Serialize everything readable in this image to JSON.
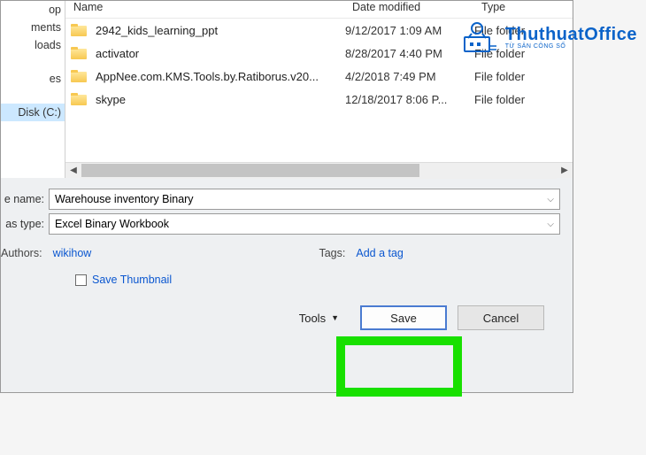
{
  "nav": {
    "items": [
      "op",
      "ments",
      "loads",
      "es",
      "",
      ""
    ],
    "selected": "Disk (C:)"
  },
  "columns": {
    "name": "Name",
    "date": "Date modified",
    "type": "Type"
  },
  "files": [
    {
      "name": "2942_kids_learning_ppt",
      "date": "9/12/2017 1:09 AM",
      "type": "File folder"
    },
    {
      "name": "activator",
      "date": "8/28/2017 4:40 PM",
      "type": "File folder"
    },
    {
      "name": "AppNee.com.KMS.Tools.by.Ratiborus.v20...",
      "date": "4/2/2018 7:49 PM",
      "type": "File folder"
    },
    {
      "name": "skype",
      "date": "12/18/2017 8:06 P...",
      "type": "File folder"
    }
  ],
  "form": {
    "name_label": "e name:",
    "name_value": "Warehouse inventory Binary",
    "type_label": "as type:",
    "type_value": "Excel Binary Workbook"
  },
  "meta": {
    "authors_label": "Authors:",
    "authors_value": "wikihow",
    "tags_label": "Tags:",
    "tags_value": "Add a tag"
  },
  "thumbnail": {
    "label": "Save Thumbnail",
    "checked": false
  },
  "buttons": {
    "tools": "Tools",
    "save": "Save",
    "cancel": "Cancel"
  },
  "watermark": {
    "title": "ThuthuatOffice",
    "sub": "TỪ SẢN CÔNG SỐ"
  }
}
